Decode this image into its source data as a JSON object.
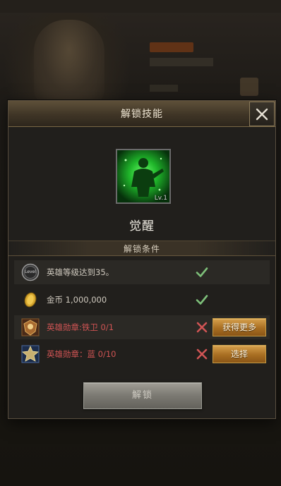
{
  "modal": {
    "title": "解锁技能",
    "close_icon": "close-icon"
  },
  "skill": {
    "name": "觉醒",
    "level": "Lv.1",
    "icon": "awakening-skill-icon",
    "accent_color": "#2bd43a"
  },
  "conditions": {
    "title": "解锁条件",
    "rows": [
      {
        "icon": "level-badge-icon",
        "icon_text": "Level",
        "text": "英雄等级达到35。",
        "met": true,
        "status_icon": "check-icon"
      },
      {
        "icon": "gold-coin-icon",
        "text": "金币 1,000,000",
        "met": true,
        "status_icon": "check-icon"
      },
      {
        "icon": "medal-iron-guard-icon",
        "text": "英雄勋章:铁卫 0/1",
        "met": false,
        "status_icon": "cross-icon",
        "button": "获得更多"
      },
      {
        "icon": "medal-blue-icon",
        "text": "英雄勋章：蓝 0/10",
        "met": false,
        "status_icon": "cross-icon",
        "button": "选择"
      }
    ]
  },
  "unlock_button": "解锁",
  "colors": {
    "met": "#7ec07a",
    "unmet": "#d05454",
    "button_gold": "#c49a45"
  }
}
